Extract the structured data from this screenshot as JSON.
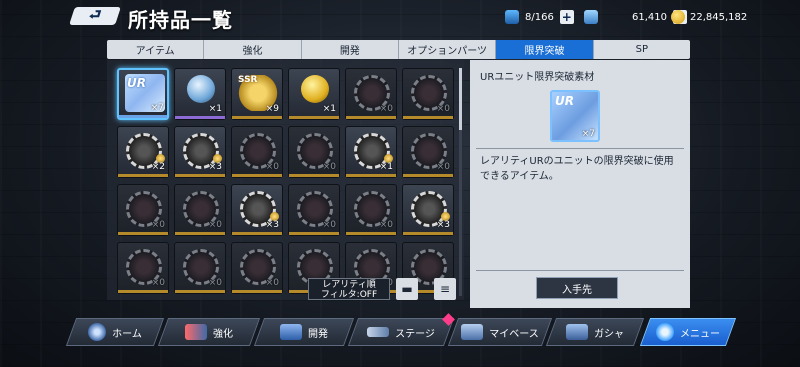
{
  "header": {
    "back_label": "⮐",
    "title": "所持品一覧",
    "stamina": "8/166",
    "gems": "61,410",
    "coins": "22,845,182"
  },
  "tabs": [
    {
      "label": "アイテム",
      "active": false
    },
    {
      "label": "強化",
      "active": false
    },
    {
      "label": "開発",
      "active": false
    },
    {
      "label": "オプションパーツ",
      "active": false
    },
    {
      "label": "限界突破",
      "active": true
    },
    {
      "label": "SP",
      "active": false
    }
  ],
  "grid": {
    "rows": [
      [
        {
          "label": "UR",
          "qty": "×7",
          "style": "ur",
          "selected": true
        },
        {
          "label": "",
          "qty": "×1",
          "style": "orb-silver"
        },
        {
          "label": "SSR",
          "qty": "×9",
          "style": "ssr"
        },
        {
          "label": "",
          "qty": "×1",
          "style": "orb-gold"
        },
        {
          "label": "",
          "qty": "×0",
          "style": "dim"
        },
        {
          "label": "",
          "qty": "×0",
          "style": "dim"
        }
      ],
      [
        {
          "label": "",
          "qty": "×2",
          "style": "lit"
        },
        {
          "label": "",
          "qty": "×3",
          "style": "lit"
        },
        {
          "label": "",
          "qty": "×0",
          "style": "dim"
        },
        {
          "label": "",
          "qty": "×0",
          "style": "dim"
        },
        {
          "label": "",
          "qty": "×1",
          "style": "lit"
        },
        {
          "label": "",
          "qty": "×0",
          "style": "dim"
        }
      ],
      [
        {
          "label": "",
          "qty": "×0",
          "style": "dim"
        },
        {
          "label": "",
          "qty": "×0",
          "style": "dim"
        },
        {
          "label": "",
          "qty": "×3",
          "style": "lit"
        },
        {
          "label": "",
          "qty": "×0",
          "style": "dim"
        },
        {
          "label": "",
          "qty": "×0",
          "style": "dim"
        },
        {
          "label": "",
          "qty": "×3",
          "style": "lit"
        }
      ],
      [
        {
          "label": "",
          "qty": "×0",
          "style": "dim"
        },
        {
          "label": "",
          "qty": "×0",
          "style": "dim"
        },
        {
          "label": "",
          "qty": "×0",
          "style": "dim"
        },
        {
          "label": "",
          "qty": "×0",
          "style": "dim"
        },
        {
          "label": "",
          "qty": "×0",
          "style": "dim"
        },
        {
          "label": "",
          "qty": "×0",
          "style": "dim"
        }
      ]
    ]
  },
  "sort": {
    "line1": "レアリティ順",
    "line2": "フィルタ:OFF"
  },
  "detail": {
    "name": "URユニット限界突破素材",
    "icon_label": "UR",
    "qty": "×7",
    "description": "レアリティURのユニットの限界突破に使用できるアイテム。",
    "obtain_label": "入手先"
  },
  "nav": [
    {
      "label": "ホーム",
      "active": false
    },
    {
      "label": "強化",
      "active": false
    },
    {
      "label": "開発",
      "active": false
    },
    {
      "label": "ステージ",
      "active": false
    },
    {
      "label": "マイベース",
      "active": false
    },
    {
      "label": "ガシャ",
      "active": false
    },
    {
      "label": "メニュー",
      "active": true
    }
  ],
  "colors": {
    "accent": "#1a6fd6",
    "panel": "#d9dee5",
    "highlight": "#5fc3ff"
  }
}
